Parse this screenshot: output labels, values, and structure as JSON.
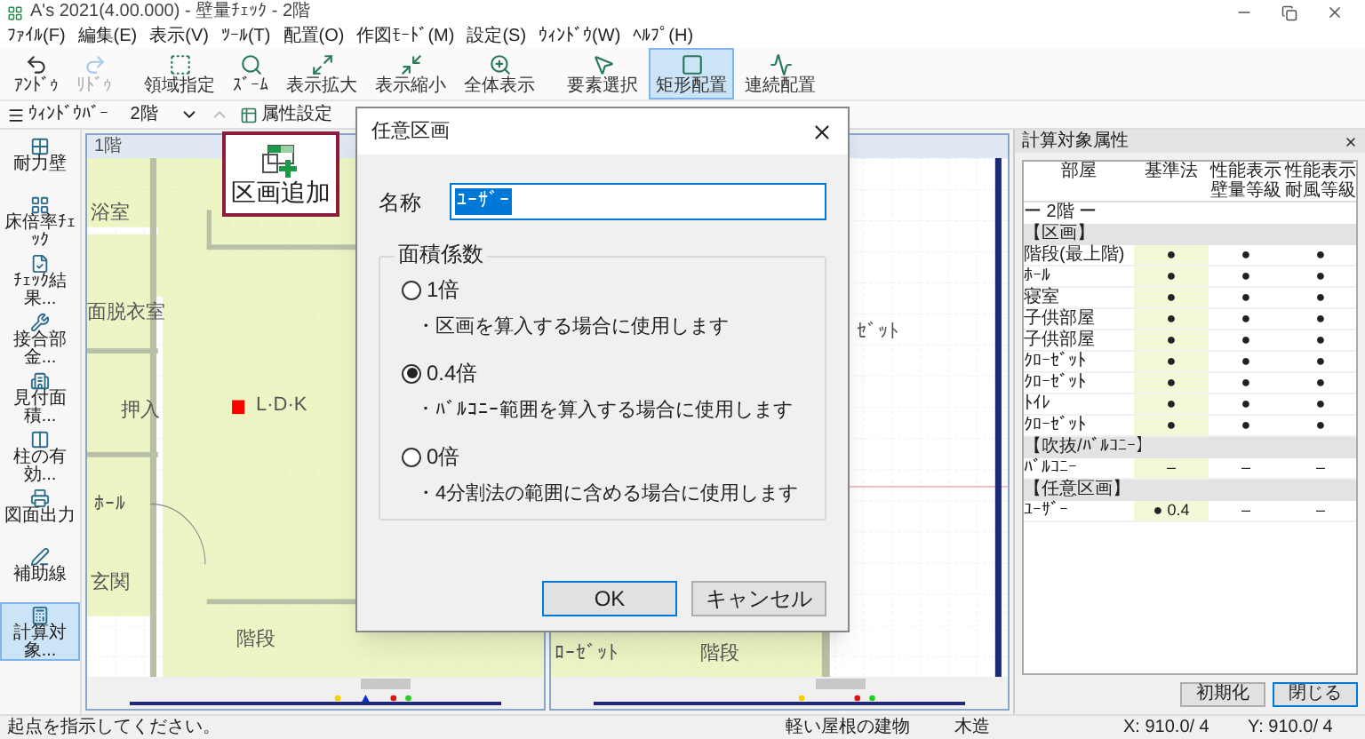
{
  "window": {
    "title": "A's 2021(4.00.000) - 壁量ﾁｪｯｸ - 2階"
  },
  "menu": [
    "ﾌｧｲﾙ(F)",
    "編集(E)",
    "表示(V)",
    "ﾂｰﾙ(T)",
    "配置(O)",
    "作図ﾓｰﾄﾞ(M)",
    "設定(S)",
    "ｳｨﾝﾄﾞｳ(W)",
    "ﾍﾙﾌﾟ(H)"
  ],
  "toolbar": [
    {
      "label": "ｱﾝﾄﾞｩ",
      "selected": false,
      "disabled": false
    },
    {
      "label": "ﾘﾄﾞｩ",
      "selected": false,
      "disabled": true
    },
    {
      "label": "領域指定",
      "selected": false,
      "disabled": false
    },
    {
      "label": "ｽﾞｰﾑ",
      "selected": false,
      "disabled": false
    },
    {
      "label": "表示拡大",
      "selected": false,
      "disabled": false
    },
    {
      "label": "表示縮小",
      "selected": false,
      "disabled": false
    },
    {
      "label": "全体表示",
      "selected": false,
      "disabled": false
    },
    {
      "label": "要素選択",
      "selected": false,
      "disabled": false
    },
    {
      "label": "矩形配置",
      "selected": true,
      "disabled": false
    },
    {
      "label": "連続配置",
      "selected": false,
      "disabled": false
    }
  ],
  "toolbar2": {
    "window_bar": "ｳｨﾝﾄﾞｳﾊﾞｰ",
    "floor": "2階",
    "attribute": "属性設定"
  },
  "callout": {
    "label": "区画追加"
  },
  "tools": [
    {
      "label": "耐力壁",
      "selected": false
    },
    {
      "label": "床倍率ﾁｪｯｸ",
      "selected": false
    },
    {
      "label": "ﾁｪｯｸ結果...",
      "selected": false
    },
    {
      "label": "接合部金...",
      "selected": false
    },
    {
      "label": "見付面積...",
      "selected": false
    },
    {
      "label": "柱の有効...",
      "selected": false
    },
    {
      "label": "図面出力",
      "selected": false
    },
    {
      "label": "補助線",
      "selected": false
    },
    {
      "label": "計算対象...",
      "selected": true
    }
  ],
  "panes": [
    {
      "title": "1階",
      "rooms": [
        "浴室",
        "面脱衣室",
        "押入",
        "L·D·K",
        "ﾎｰﾙ",
        "玄関",
        "階段"
      ]
    },
    {
      "rooms": [
        "ｾﾞｯﾄ",
        "ﾛｰｾﾞｯﾄ",
        "階段"
      ]
    }
  ],
  "dialog": {
    "title": "任意区画",
    "name_label": "名称",
    "name_value": "ﾕｰｻﾞｰ",
    "group": "面積係数",
    "options": [
      {
        "label": "1倍",
        "note": "・区画を算入する場合に使用します",
        "selected": false
      },
      {
        "label": "0.4倍",
        "note": "・ﾊﾞﾙｺﾆｰ範囲を算入する場合に使用します",
        "selected": true
      },
      {
        "label": "0倍",
        "note": "・4分割法の範囲に含める場合に使用します",
        "selected": false
      }
    ],
    "buttons": [
      "OK",
      "キャンセル"
    ]
  },
  "attributes_panel": {
    "title": "計算対象属性",
    "columns": [
      "部屋",
      "基準法",
      "性能表示壁量等級",
      "性能表示耐風等級"
    ],
    "rows": [
      {
        "kind": "floor",
        "name": "ー 2階 ー"
      },
      {
        "kind": "section",
        "name": "【区画】"
      },
      {
        "kind": "room",
        "name": "階段(最上階)",
        "cells": [
          "●",
          "●",
          "●"
        ]
      },
      {
        "kind": "room",
        "name": "ﾎｰﾙ",
        "cells": [
          "●",
          "●",
          "●"
        ]
      },
      {
        "kind": "room",
        "name": "寝室",
        "cells": [
          "●",
          "●",
          "●"
        ]
      },
      {
        "kind": "room",
        "name": "子供部屋",
        "cells": [
          "●",
          "●",
          "●"
        ]
      },
      {
        "kind": "room",
        "name": "子供部屋",
        "cells": [
          "●",
          "●",
          "●"
        ]
      },
      {
        "kind": "room",
        "name": "ｸﾛｰｾﾞｯﾄ",
        "cells": [
          "●",
          "●",
          "●"
        ]
      },
      {
        "kind": "room",
        "name": "ｸﾛｰｾﾞｯﾄ",
        "cells": [
          "●",
          "●",
          "●"
        ]
      },
      {
        "kind": "room",
        "name": "ﾄｲﾚ",
        "cells": [
          "●",
          "●",
          "●"
        ]
      },
      {
        "kind": "room",
        "name": "ｸﾛｰｾﾞｯﾄ",
        "cells": [
          "●",
          "●",
          "●"
        ]
      },
      {
        "kind": "section",
        "name": "【吹抜/ﾊﾞﾙｺﾆｰ】"
      },
      {
        "kind": "room",
        "name": "ﾊﾞﾙｺﾆｰ",
        "cells": [
          "–",
          "–",
          "–"
        ]
      },
      {
        "kind": "section",
        "name": "【任意区画】"
      },
      {
        "kind": "room",
        "name": "ﾕｰｻﾞｰ",
        "cells": [
          "● 0.4",
          "–",
          "–"
        ]
      }
    ],
    "buttons": [
      "初期化",
      "閉じる"
    ]
  },
  "status_bar": [
    "起点を指示してください。",
    "軽い屋根の建物",
    "木造",
    "X: 910.0/ 4",
    "Y: 910.0/ 4"
  ]
}
